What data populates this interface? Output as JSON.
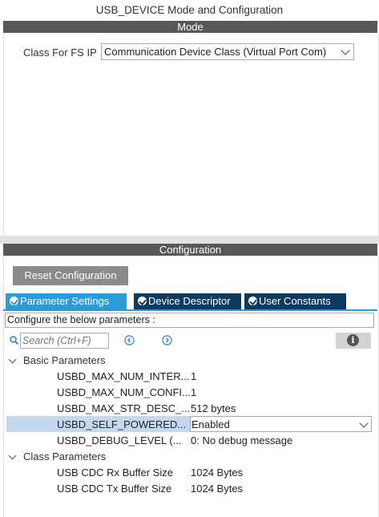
{
  "window": {
    "title": "USB_DEVICE Mode and Configuration"
  },
  "mode": {
    "header": "Mode",
    "class_label": "Class For FS IP",
    "class_value": "Communication Device Class (Virtual Port Com)"
  },
  "configuration": {
    "header": "Configuration",
    "reset_label": "Reset Configuration",
    "tabs": [
      {
        "label": "Parameter Settings",
        "active": true
      },
      {
        "label": "Device Descriptor",
        "active": false
      },
      {
        "label": "User Constants",
        "active": false
      }
    ],
    "instruction": "Configure the below parameters :",
    "search": {
      "placeholder": "Search (Ctrl+F)"
    },
    "groups": [
      {
        "name": "Basic Parameters",
        "params": [
          {
            "name": "USBD_MAX_NUM_INTER...",
            "value": "1"
          },
          {
            "name": "USBD_MAX_NUM_CONFI...",
            "value": "1"
          },
          {
            "name": "USBD_MAX_STR_DESC_...",
            "value": "512 bytes"
          },
          {
            "name": "USBD_SELF_POWERED...",
            "value": "Enabled",
            "selected": true
          },
          {
            "name": "USBD_DEBUG_LEVEL (...",
            "value": "0: No debug message"
          }
        ]
      },
      {
        "name": "Class Parameters",
        "params": [
          {
            "name": "USB CDC Rx Buffer Size",
            "value": "1024 Bytes"
          },
          {
            "name": "USB CDC Tx Buffer Size",
            "value": "1024 Bytes"
          }
        ]
      }
    ]
  },
  "colors": {
    "header_bg": "#585858",
    "tab_active": "#2b9cd8",
    "tab_inactive": "#0d3a5e",
    "selected_row": "#c5d9ee",
    "reset_button": "#8a8a8a"
  },
  "icons": {
    "search": "search-icon",
    "prev": "circle-chevron-left-icon",
    "next": "circle-chevron-right-icon",
    "info": "info-icon"
  }
}
